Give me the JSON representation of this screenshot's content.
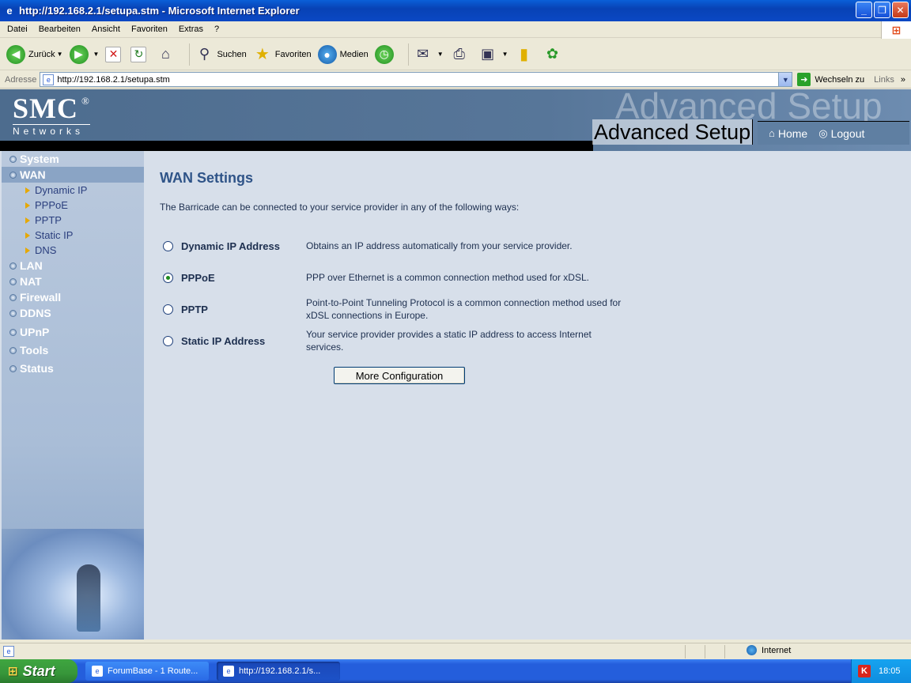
{
  "window": {
    "title": "http://192.168.2.1/setupa.stm - Microsoft Internet Explorer"
  },
  "menu": [
    "Datei",
    "Bearbeiten",
    "Ansicht",
    "Favoriten",
    "Extras",
    "?"
  ],
  "toolbar": {
    "back": "Zurück",
    "search": "Suchen",
    "favorites": "Favoriten",
    "media": "Medien"
  },
  "address": {
    "label": "Adresse",
    "url": "http://192.168.2.1/setupa.stm",
    "go": "Wechseln zu",
    "links": "Links"
  },
  "banner": {
    "logo": "SMC",
    "logo_mark": "®",
    "logo_sub": "Networks",
    "ghost_title": "Advanced Setup",
    "title": "Advanced Setup",
    "home": "Home",
    "logout": "Logout"
  },
  "sidebar": {
    "items": [
      {
        "label": "System"
      },
      {
        "label": "WAN",
        "active": true,
        "sub": [
          "Dynamic IP",
          "PPPoE",
          "PPTP",
          "Static IP",
          "DNS"
        ]
      },
      {
        "label": "LAN"
      },
      {
        "label": "NAT"
      },
      {
        "label": "Firewall"
      },
      {
        "label": "DDNS"
      },
      {
        "label": "UPnP"
      },
      {
        "label": "Tools"
      },
      {
        "label": "Status"
      }
    ]
  },
  "content": {
    "heading": "WAN Settings",
    "intro": "The Barricade can be connected to your service provider in any of the following ways:",
    "options": [
      {
        "name": "Dynamic IP Address",
        "desc": "Obtains an IP address automatically from your service provider.",
        "selected": false
      },
      {
        "name": "PPPoE",
        "desc": "PPP over Ethernet is a common connection method used for xDSL.",
        "selected": true
      },
      {
        "name": "PPTP",
        "desc": "Point-to-Point Tunneling Protocol is a common connection method used for xDSL connections in Europe.",
        "selected": false
      },
      {
        "name": "Static IP Address",
        "desc": "Your service provider provides a static IP address to access Internet services.",
        "selected": false
      }
    ],
    "button": "More Configuration"
  },
  "status": {
    "zone": "Internet"
  },
  "taskbar": {
    "start": "Start",
    "tasks": [
      "ForumBase - 1 Route...",
      "http://192.168.2.1/s..."
    ],
    "clock": "18:05"
  },
  "colors": {
    "heading": "#2f5488",
    "banner": "#577699",
    "sidebar": "#a9bdd7",
    "page_bg": "#d7dfea"
  }
}
